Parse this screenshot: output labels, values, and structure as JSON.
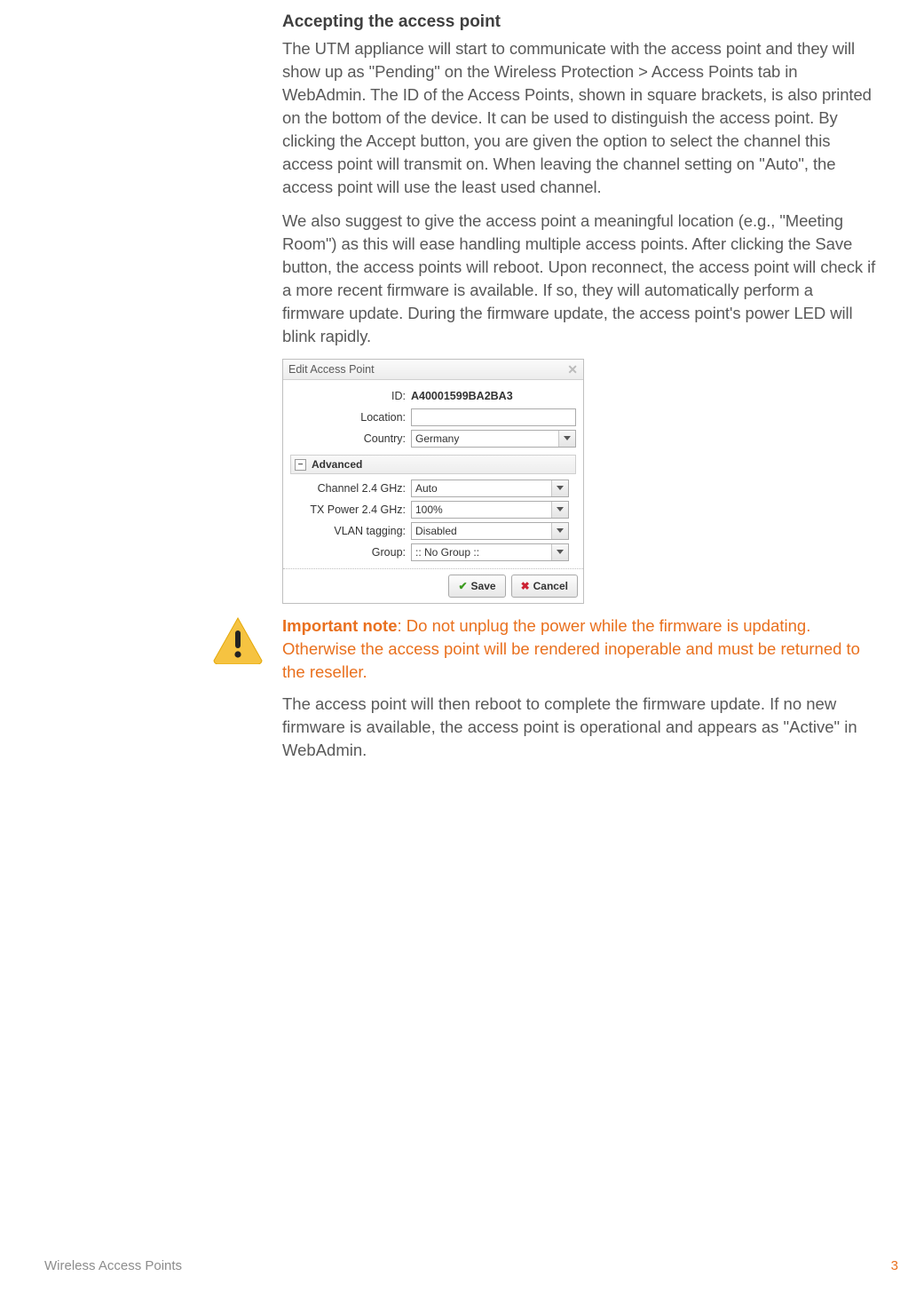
{
  "heading": "Accepting the access point",
  "paragraph1": "The UTM appliance will start to communicate with the access point and they will show up as \"Pending\" on the Wireless Protection > Access Points tab in WebAdmin. The ID of the Access Points, shown in square brackets, is also printed on the bottom of the device. It can be used to distinguish the access point. By clicking the Accept button, you are given the option to select the channel this access point will transmit on. When leaving the channel setting on \"Auto\", the access point will use the least used channel.",
  "paragraph2": "We also suggest to give the access point a meaningful location (e.g., \"Meeting Room\") as this will ease handling multiple access points. After clicking the Save button, the access points will reboot. Upon reconnect, the access point will check if a more recent firmware is available. If so, they will automatically perform a firmware update. During the firmware update, the access point's power LED will blink rapidly.",
  "dialog": {
    "title": "Edit Access Point",
    "fields": {
      "id_label": "ID:",
      "id_value": "A40001599BA2BA3",
      "location_label": "Location:",
      "location_value": "",
      "country_label": "Country:",
      "country_value": "Germany"
    },
    "advanced_label": "Advanced",
    "advanced": {
      "channel_label": "Channel 2.4 GHz:",
      "channel_value": "Auto",
      "txpower_label": "TX Power 2.4 GHz:",
      "txpower_value": "100%",
      "vlan_label": "VLAN tagging:",
      "vlan_value": "Disabled",
      "group_label": "Group:",
      "group_value": ":: No Group ::"
    },
    "save_label": "Save",
    "cancel_label": "Cancel"
  },
  "note": {
    "lead": "Important note",
    "text": ": Do not unplug the power while the firmware is updating. Otherwise the access point will be rendered inoperable and must be returned to the reseller.",
    "after": "The access point will then reboot to complete the firmware update. If no new firmware is available, the access point is operational and appears as \"Active\" in WebAdmin."
  },
  "footer": {
    "doc_title": "Wireless Access Points",
    "page_number": "3"
  }
}
